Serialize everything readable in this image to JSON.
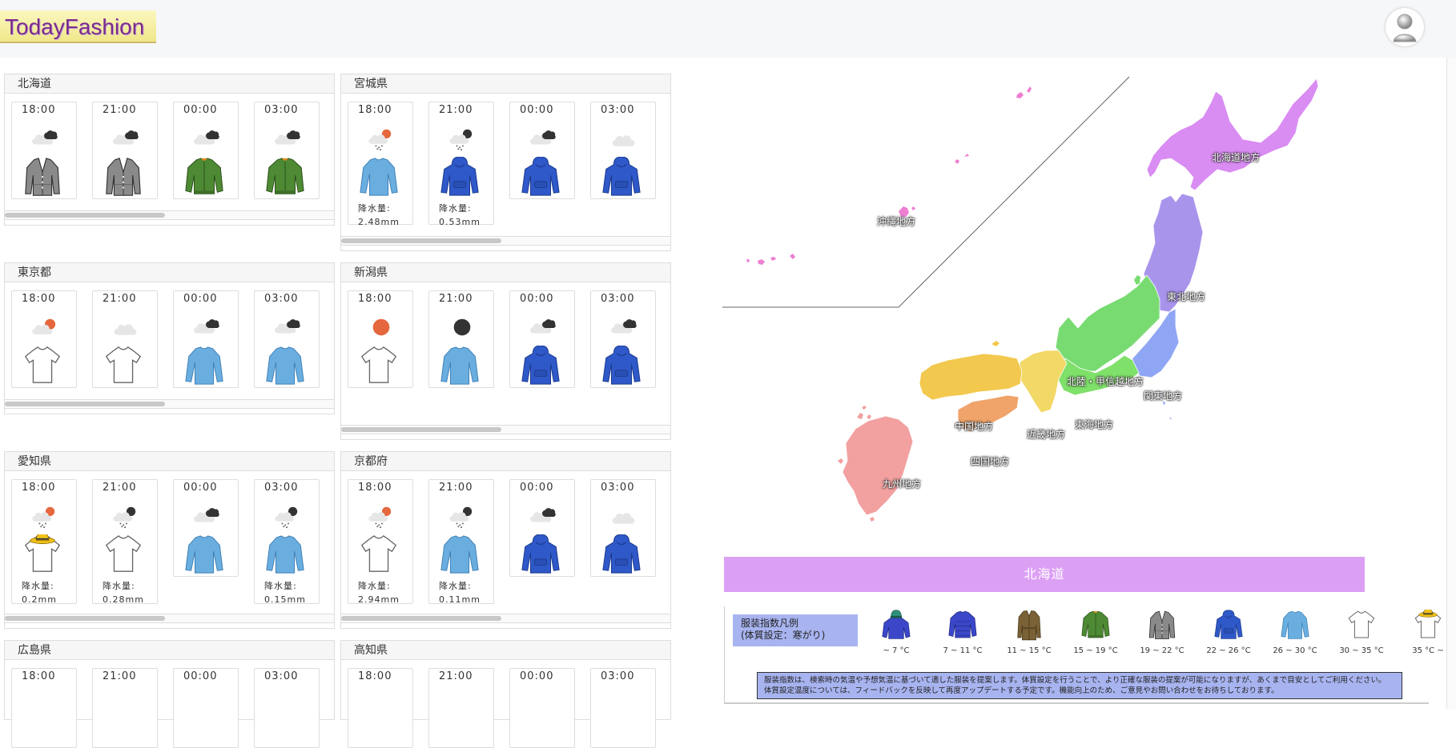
{
  "app": {
    "logo": "TodayFashion"
  },
  "prefectures": [
    {
      "name": "北海道",
      "slots": [
        {
          "time": "18:00",
          "weather": "cloudy-night-icon",
          "cloth": "cardigan-icon",
          "precip": ""
        },
        {
          "time": "21:00",
          "weather": "cloudy-night-icon",
          "cloth": "cardigan-icon",
          "precip": ""
        },
        {
          "time": "00:00",
          "weather": "cloudy-night-icon",
          "cloth": "bomber-jacket-icon",
          "precip": ""
        },
        {
          "time": "03:00",
          "weather": "cloudy-night-icon",
          "cloth": "bomber-jacket-icon",
          "precip": ""
        }
      ]
    },
    {
      "name": "宮城県",
      "slots": [
        {
          "time": "18:00",
          "weather": "rain-sun-icon",
          "cloth": "long-sleeve-icon",
          "precip": "降水量:",
          "precip_val": "2.48mm"
        },
        {
          "time": "21:00",
          "weather": "rain-night-icon",
          "cloth": "hoodie-icon",
          "precip": "降水量:",
          "precip_val": "0.53mm"
        },
        {
          "time": "00:00",
          "weather": "cloudy-night-icon",
          "cloth": "hoodie-icon",
          "precip": ""
        },
        {
          "time": "03:00",
          "weather": "cloud-icon",
          "cloth": "hoodie-icon",
          "precip": ""
        }
      ]
    },
    {
      "name": "東京都",
      "slots": [
        {
          "time": "18:00",
          "weather": "partly-sunny-icon",
          "cloth": "tshirt-icon",
          "precip": ""
        },
        {
          "time": "21:00",
          "weather": "cloud-icon",
          "cloth": "tshirt-icon",
          "precip": ""
        },
        {
          "time": "00:00",
          "weather": "cloudy-night-icon",
          "cloth": "long-sleeve-icon",
          "precip": ""
        },
        {
          "time": "03:00",
          "weather": "cloudy-night-icon",
          "cloth": "long-sleeve-icon",
          "precip": ""
        }
      ]
    },
    {
      "name": "新潟県",
      "slots": [
        {
          "time": "18:00",
          "weather": "sun-icon",
          "cloth": "tshirt-icon",
          "precip": ""
        },
        {
          "time": "21:00",
          "weather": "moon-icon",
          "cloth": "long-sleeve-icon",
          "precip": ""
        },
        {
          "time": "00:00",
          "weather": "cloudy-night-icon",
          "cloth": "hoodie-icon",
          "precip": ""
        },
        {
          "time": "03:00",
          "weather": "cloudy-night-icon",
          "cloth": "hoodie-icon",
          "precip": ""
        }
      ]
    },
    {
      "name": "愛知県",
      "slots": [
        {
          "time": "18:00",
          "weather": "rain-sun-icon",
          "cloth": "tshirt-hat-icon",
          "precip": "降水量:",
          "precip_val": "0.2mm"
        },
        {
          "time": "21:00",
          "weather": "rain-night-icon",
          "cloth": "tshirt-icon",
          "precip": "降水量:",
          "precip_val": "0.28mm"
        },
        {
          "time": "00:00",
          "weather": "cloudy-night-icon",
          "cloth": "long-sleeve-icon",
          "precip": ""
        },
        {
          "time": "03:00",
          "weather": "rain-night-icon",
          "cloth": "long-sleeve-icon",
          "precip": "降水量:",
          "precip_val": "0.15mm"
        }
      ]
    },
    {
      "name": "京都府",
      "slots": [
        {
          "time": "18:00",
          "weather": "rain-sun-icon",
          "cloth": "tshirt-icon",
          "precip": "降水量:",
          "precip_val": "2.94mm"
        },
        {
          "time": "21:00",
          "weather": "rain-night-icon",
          "cloth": "long-sleeve-icon",
          "precip": "降水量:",
          "precip_val": "0.11mm"
        },
        {
          "time": "00:00",
          "weather": "cloudy-night-icon",
          "cloth": "hoodie-icon",
          "precip": ""
        },
        {
          "time": "03:00",
          "weather": "cloud-icon",
          "cloth": "hoodie-icon",
          "precip": ""
        }
      ]
    },
    {
      "name": "広島県",
      "slots": [
        {
          "time": "18:00"
        },
        {
          "time": "21:00"
        },
        {
          "time": "00:00"
        },
        {
          "time": "03:00"
        }
      ]
    },
    {
      "name": "高知県",
      "slots": [
        {
          "time": "18:00"
        },
        {
          "time": "21:00"
        },
        {
          "time": "00:00"
        },
        {
          "time": "03:00"
        }
      ]
    }
  ],
  "map": {
    "regions": [
      {
        "label": "北海道地方",
        "color": "#d98cf2"
      },
      {
        "label": "沖縄地方",
        "color": "#ee7fd2"
      },
      {
        "label": "東北地方",
        "color": "#a994ec"
      },
      {
        "label": "北陸・甲信越地方",
        "color": "#78db72"
      },
      {
        "label": "関東地方",
        "color": "#8fa6f5"
      },
      {
        "label": "東海地方",
        "color": "#7fe06a"
      },
      {
        "label": "中国地方",
        "color": "#f2c84e"
      },
      {
        "label": "近畿地方",
        "color": "#f2d866"
      },
      {
        "label": "四国地方",
        "color": "#f0a46a"
      },
      {
        "label": "九州地方",
        "color": "#f2a0a0"
      }
    ]
  },
  "selected_banner": "北海道",
  "legend": {
    "title_line1": "服装指数凡例",
    "title_line2": "(体質設定：寒がり)",
    "items": [
      {
        "icon": "knit-hat-down-jacket-icon",
        "range": "~ 7 °C"
      },
      {
        "icon": "down-jacket-icon",
        "range": "7 ~ 11 °C"
      },
      {
        "icon": "trench-coat-icon",
        "range": "11 ~ 15 °C"
      },
      {
        "icon": "bomber-jacket-icon",
        "range": "15 ~ 19 °C"
      },
      {
        "icon": "cardigan-icon",
        "range": "19 ~ 22 °C"
      },
      {
        "icon": "hoodie-icon",
        "range": "22 ~ 26 °C"
      },
      {
        "icon": "long-sleeve-icon",
        "range": "26 ~ 30 °C"
      },
      {
        "icon": "tshirt-icon",
        "range": "30 ~ 35 °C"
      },
      {
        "icon": "tshirt-hat-icon",
        "range": "35 °C ~"
      }
    ],
    "note_line1": "服装指数は、検索時の気温や予想気温に基づいて適した服装を提案します。体質設定を行うことで、より正確な服装の提案が可能になりますが、あくまで目安としてご利用ください。",
    "note_line2": "体質設定温度については、フィードバックを反映して再度アップデートする予定です。機能向上のため、ご意見やお問い合わせをお待ちしております。"
  },
  "colors": {
    "accent": "#dba0f4",
    "legend_bg": "#a8b4f0",
    "logo_text": "#7a2a8c"
  }
}
